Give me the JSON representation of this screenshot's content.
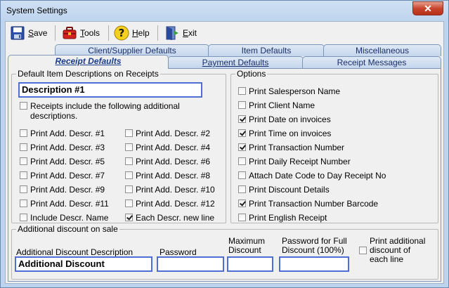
{
  "window": {
    "title": "System Settings",
    "close_glyph": "✕"
  },
  "toolbar": {
    "items": [
      {
        "key": "S",
        "rest": "ave",
        "icon": "save-icon"
      },
      {
        "key": "T",
        "rest": "ools",
        "icon": "toolbox-icon"
      },
      {
        "key": "H",
        "rest": "elp",
        "icon": "help-icon"
      },
      {
        "key": "E",
        "rest": "xit",
        "icon": "exit-icon"
      }
    ]
  },
  "tabs": {
    "row_back": [
      "Client/Supplier Defaults",
      "Item Defaults",
      "Miscellaneous"
    ],
    "row_front": [
      "Receipt Defaults",
      "Payment Defaults",
      "Receipt Messages"
    ],
    "active": "Receipt Defaults"
  },
  "descriptions_group": {
    "title": "Default Item Descriptions on Receipts",
    "description_value": "Description #1",
    "include_additional": {
      "label_line1": "Receipts include the following additional",
      "label_line2": "descriptions.",
      "checked": false
    },
    "left_col": [
      {
        "label": "Print Add. Descr. #1",
        "checked": false
      },
      {
        "label": "Print Add. Descr. #3",
        "checked": false
      },
      {
        "label": "Print Add. Descr. #5",
        "checked": false
      },
      {
        "label": "Print Add. Descr. #7",
        "checked": false
      },
      {
        "label": "Print Add. Descr. #9",
        "checked": false
      },
      {
        "label": "Print Add. Descr. #11",
        "checked": false
      },
      {
        "label": "Include Descr. Name",
        "checked": false
      }
    ],
    "right_col": [
      {
        "label": "Print Add. Descr. #2",
        "checked": false
      },
      {
        "label": "Print Add. Descr. #4",
        "checked": false
      },
      {
        "label": "Print Add. Descr. #6",
        "checked": false
      },
      {
        "label": "Print Add. Descr. #8",
        "checked": false
      },
      {
        "label": "Print Add. Descr. #10",
        "checked": false
      },
      {
        "label": "Print Add. Descr. #12",
        "checked": false
      },
      {
        "label": "Each Descr. new line",
        "checked": true
      }
    ]
  },
  "options_group": {
    "title": "Options",
    "items": [
      {
        "label": "Print Salesperson Name",
        "checked": false
      },
      {
        "label": "Print Client Name",
        "checked": false
      },
      {
        "label": "Print Date on invoices",
        "checked": true
      },
      {
        "label": "Print Time on invoices",
        "checked": true
      },
      {
        "label": "Print Transaction Number",
        "checked": true
      },
      {
        "label": "Print Daily Receipt Number",
        "checked": false
      },
      {
        "label": "Attach Date Code to Day Receipt No",
        "checked": false
      },
      {
        "label": "Print Discount Details",
        "checked": false
      },
      {
        "label": "Print Transaction Number Barcode",
        "checked": true
      },
      {
        "label": "Print English Receipt",
        "checked": false
      }
    ]
  },
  "discount_group": {
    "title": "Additional discount on sale",
    "description_label": "Additional Discount Description",
    "description_value": "Additional Discount",
    "password_label": "Password",
    "password_value": "",
    "maximum_label_line1": "Maximum",
    "maximum_label_line2": "Discount",
    "maximum_value": "",
    "full_password_label_line1": "Password for Full",
    "full_password_label_line2": "Discount (100%)",
    "full_password_value": "",
    "print_additional": {
      "line1": "Print additional",
      "line2": "discount of",
      "line3": "each line",
      "checked": false
    }
  }
}
